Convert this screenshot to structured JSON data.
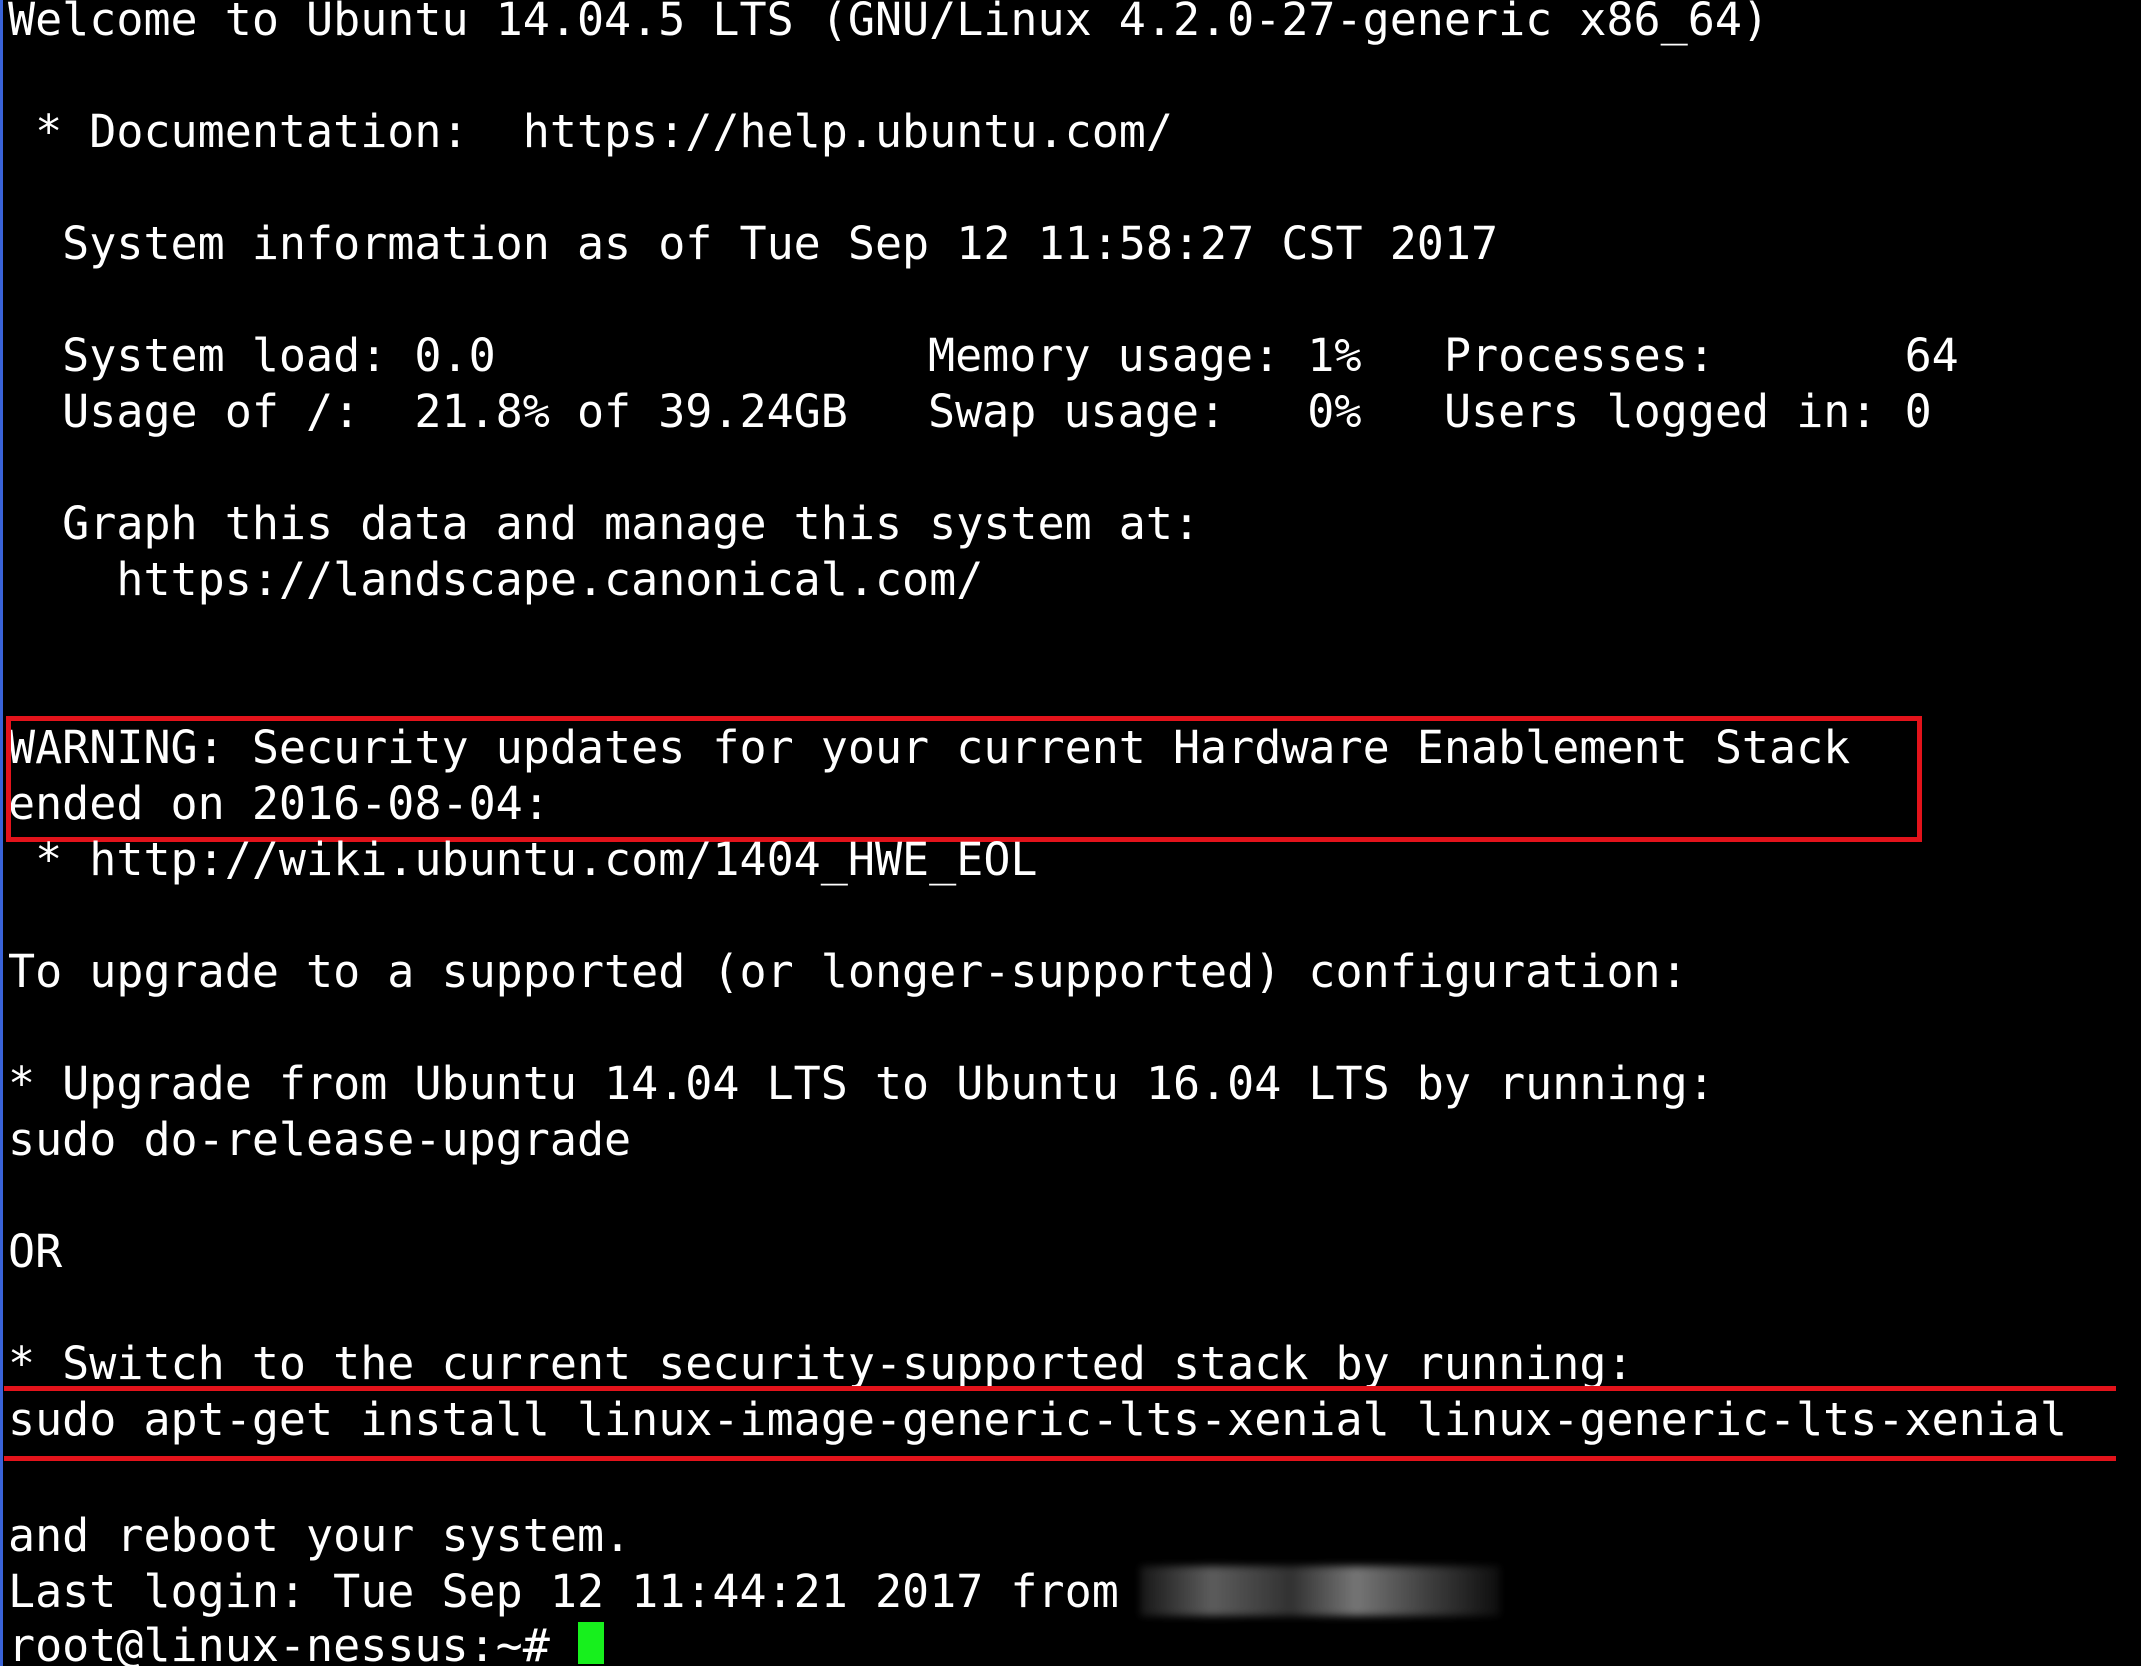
{
  "terminal": {
    "welcome": "Welcome to Ubuntu 14.04.5 LTS (GNU/Linux 4.2.0-27-generic x86_64)",
    "documentation": " * Documentation:  https://help.ubuntu.com/",
    "sysinfo_header": "  System information as of Tue Sep 12 11:58:27 CST 2017",
    "stats": {
      "system_load": "  System load: 0.0",
      "usage_root": "  Usage of /:  21.8% of 39.24GB",
      "memory_usage": "Memory usage: 1%",
      "swap_usage": "Swap usage:   0%",
      "processes": "Processes:       64",
      "users_logged_in": "Users logged in: 0"
    },
    "graph_line": "  Graph this data and manage this system at:",
    "landscape_url": "    https://landscape.canonical.com/",
    "warning_line1": "WARNING: Security updates for your current Hardware Enablement Stack",
    "warning_line2": "ended on 2016-08-04:",
    "hwe_eol_url": " * http://wiki.ubuntu.com/1404_HWE_EOL",
    "to_upgrade": "To upgrade to a supported (or longer-supported) configuration:",
    "upgrade_from": "* Upgrade from Ubuntu 14.04 LTS to Ubuntu 16.04 LTS by running:",
    "release_upgrade_cmd": "sudo do-release-upgrade",
    "or": "OR",
    "switch_stack": "* Switch to the current security-supported stack by running:",
    "install_cmd": "sudo apt-get install linux-image-generic-lts-xenial linux-generic-lts-xenial",
    "reboot": "and reboot your system.",
    "last_login": "Last login: Tue Sep 12 11:44:21 2017 from",
    "prompt": "root@linux-nessus:~# "
  },
  "colors": {
    "background": "#000000",
    "text": "#ffffff",
    "highlight": "#e3131b",
    "cursor": "#17f01d",
    "border": "#3a63d8"
  }
}
